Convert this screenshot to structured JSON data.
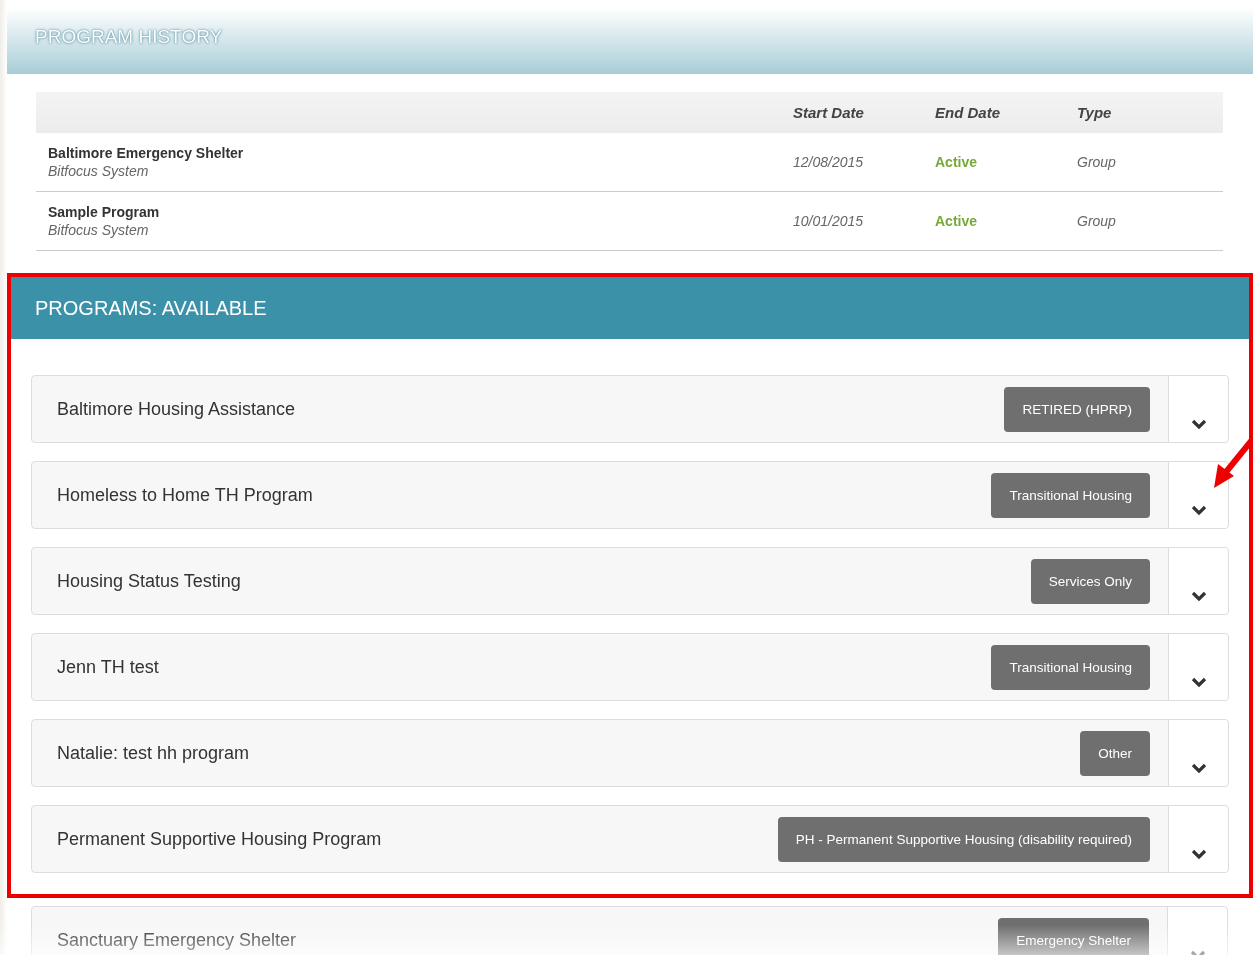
{
  "history": {
    "title": "PROGRAM HISTORY",
    "columns": [
      "",
      "Start Date",
      "End Date",
      "Type"
    ],
    "rows": [
      {
        "program": "Baltimore Emergency Shelter",
        "system": "Bitfocus System",
        "start": "12/08/2015",
        "end": "Active",
        "type": "Group"
      },
      {
        "program": "Sample Program",
        "system": "Bitfocus System",
        "start": "10/01/2015",
        "end": "Active",
        "type": "Group"
      }
    ]
  },
  "available": {
    "title": "PROGRAMS: AVAILABLE",
    "programs": [
      {
        "name": "Baltimore Housing Assistance",
        "tag": "RETIRED (HPRP)"
      },
      {
        "name": "Homeless to Home TH Program",
        "tag": "Transitional Housing"
      },
      {
        "name": "Housing Status Testing",
        "tag": "Services Only"
      },
      {
        "name": "Jenn TH test",
        "tag": "Transitional Housing"
      },
      {
        "name": "Natalie: test hh program",
        "tag": "Other"
      },
      {
        "name": "Permanent Supportive Housing Program",
        "tag": "PH - Permanent Supportive Housing (disability required)"
      }
    ],
    "below": [
      {
        "name": "Sanctuary Emergency Shelter",
        "tag": "Emergency Shelter"
      }
    ]
  }
}
